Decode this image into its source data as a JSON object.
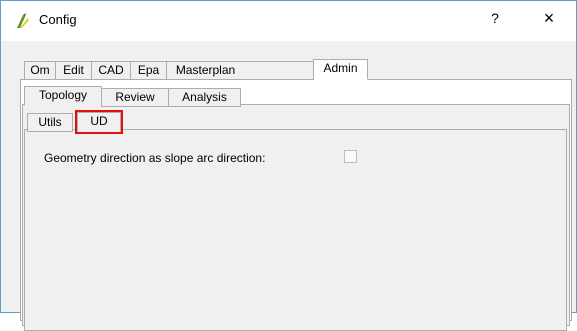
{
  "window": {
    "title": "Config",
    "help_label": "?",
    "close_label": "×"
  },
  "tabs_level1": [
    {
      "label": "Om"
    },
    {
      "label": "Edit"
    },
    {
      "label": "CAD"
    },
    {
      "label": "Epa"
    },
    {
      "label": "Masterplan"
    },
    {
      "label": "Admin",
      "active": true
    }
  ],
  "tabs_level2": [
    {
      "label": "Topology",
      "active": true
    },
    {
      "label": "Review"
    },
    {
      "label": "Analysis"
    }
  ],
  "tabs_level3": [
    {
      "label": "Utils"
    },
    {
      "label": "UD",
      "active": true,
      "highlighted": true
    }
  ],
  "settings": {
    "geometry_direction_label": "Geometry direction as slope arc direction:",
    "geometry_direction_checked": false
  },
  "colors": {
    "highlight": "#e01010",
    "frame_border": "#5f9fcf",
    "logo_green": "#5a9a2a",
    "logo_yellow": "#e8c820"
  },
  "icons": {
    "app_icon": "qgis-logo-icon"
  }
}
